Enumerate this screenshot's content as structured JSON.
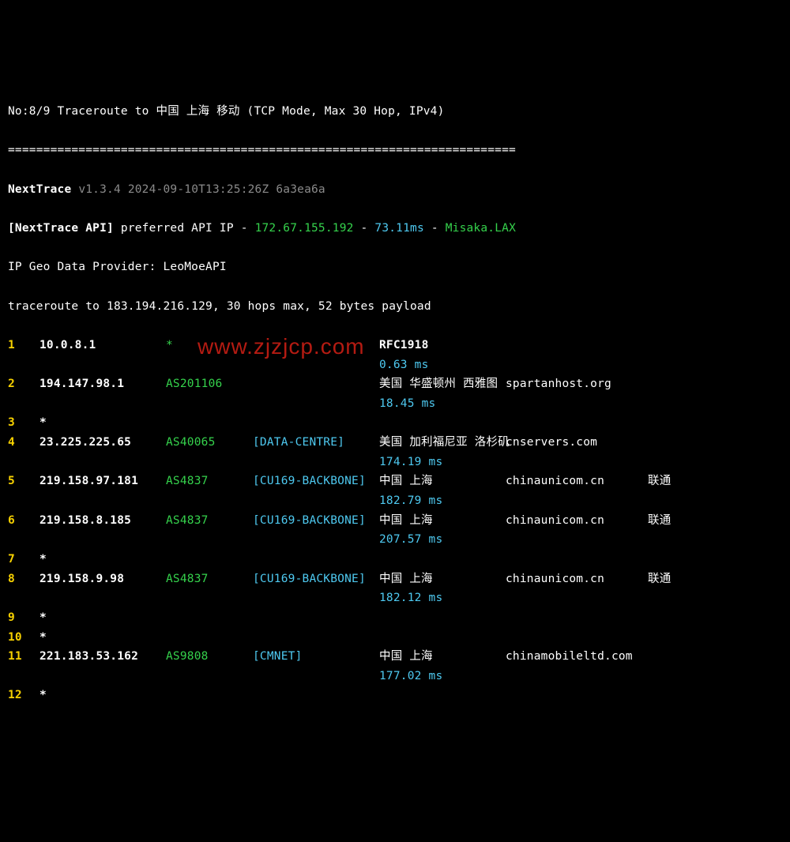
{
  "header": {
    "title": "No:8/9 Traceroute to 中国 上海 移动 (TCP Mode, Max 30 Hop, IPv4)",
    "sep": "========================================================================",
    "app_name": "NextTrace",
    "version": "v1.3.4 2024-09-10T13:25:26Z 6a3ea6a",
    "api_label": "[NextTrace API]",
    "api_text": " preferred API IP - ",
    "api_ip": "172.67.155.192",
    "api_sep1": " - ",
    "api_ms": "73.11ms",
    "api_sep2": " - ",
    "api_loc": "Misaka.LAX",
    "geo": "IP Geo Data Provider: LeoMoeAPI",
    "tr": "traceroute to 183.194.216.129, 30 hops max, 52 bytes payload"
  },
  "watermark": "www.zjzjcp.com",
  "hops": [
    {
      "n": "1",
      "ip": "10.0.8.1",
      "asn": "*",
      "tag": "",
      "loc": "RFC1918",
      "dom": "",
      "isp": "",
      "ms": "0.63 ms"
    },
    {
      "n": "2",
      "ip": "194.147.98.1",
      "asn": "AS201106",
      "tag": "",
      "loc": "美国 华盛顿州 西雅图",
      "dom": "spartanhost.org",
      "isp": "",
      "ms": "18.45 ms"
    },
    {
      "n": "3",
      "ip": "*",
      "asn": "",
      "tag": "",
      "loc": "",
      "dom": "",
      "isp": "",
      "ms": ""
    },
    {
      "n": "4",
      "ip": "23.225.225.65",
      "asn": "AS40065",
      "tag": "[DATA-CENTRE]",
      "loc": "美国 加利福尼亚 洛杉矶",
      "dom": "cnservers.com",
      "isp": "",
      "ms": "174.19 ms"
    },
    {
      "n": "5",
      "ip": "219.158.97.181",
      "asn": "AS4837",
      "tag": "[CU169-BACKBONE]",
      "loc": "中国 上海",
      "dom": "chinaunicom.cn",
      "isp": "联通",
      "ms": "182.79 ms"
    },
    {
      "n": "6",
      "ip": "219.158.8.185",
      "asn": "AS4837",
      "tag": "[CU169-BACKBONE]",
      "loc": "中国 上海",
      "dom": "chinaunicom.cn",
      "isp": "联通",
      "ms": "207.57 ms"
    },
    {
      "n": "7",
      "ip": "*",
      "asn": "",
      "tag": "",
      "loc": "",
      "dom": "",
      "isp": "",
      "ms": ""
    },
    {
      "n": "8",
      "ip": "219.158.9.98",
      "asn": "AS4837",
      "tag": "[CU169-BACKBONE]",
      "loc": "中国 上海",
      "dom": "chinaunicom.cn",
      "isp": "联通",
      "ms": "182.12 ms"
    },
    {
      "n": "9",
      "ip": "*",
      "asn": "",
      "tag": "",
      "loc": "",
      "dom": "",
      "isp": "",
      "ms": ""
    },
    {
      "n": "10",
      "ip": "*",
      "asn": "",
      "tag": "",
      "loc": "",
      "dom": "",
      "isp": "",
      "ms": ""
    },
    {
      "n": "11",
      "ip": "221.183.53.162",
      "asn": "AS9808",
      "tag": "[CMNET]",
      "loc": "中国 上海",
      "dom": "chinamobileltd.com",
      "isp": "",
      "ms": "177.02 ms"
    },
    {
      "n": "12",
      "ip": "*",
      "asn": "",
      "tag": "",
      "loc": "",
      "dom": "",
      "isp": "",
      "ms": ""
    }
  ]
}
